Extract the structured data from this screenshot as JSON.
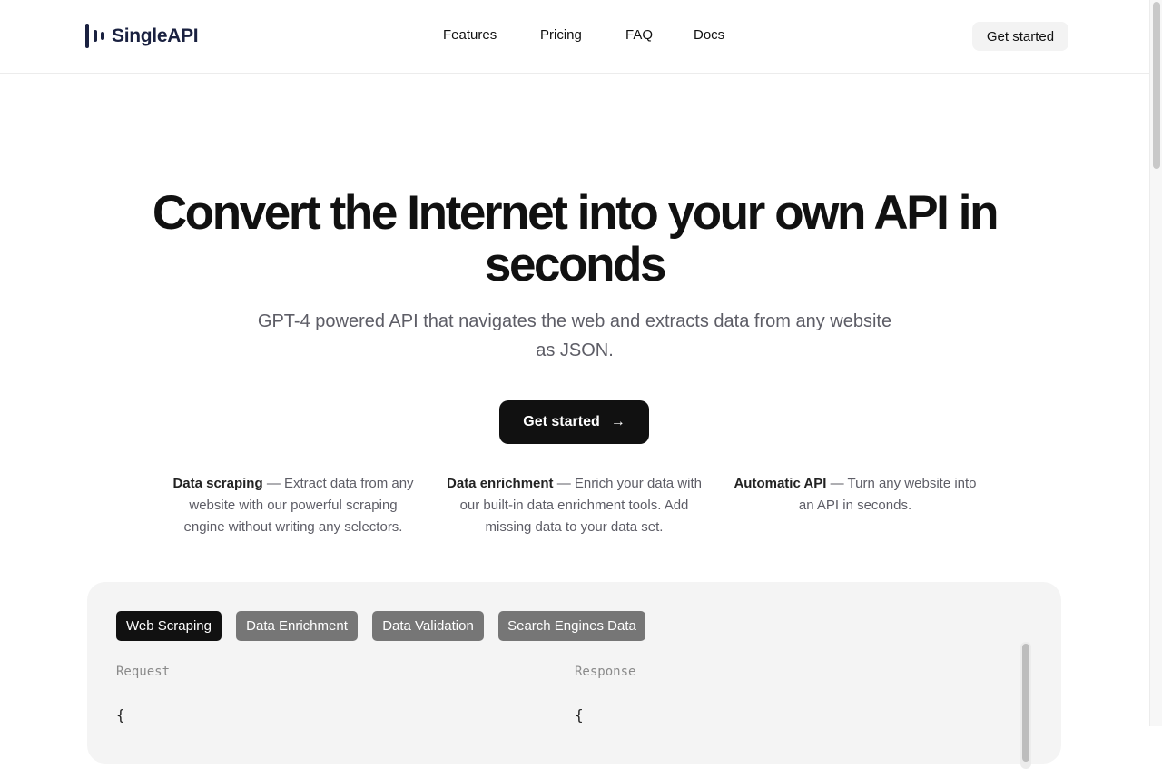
{
  "header": {
    "logo_text": "SingleAPI",
    "nav": [
      {
        "label": "Features"
      },
      {
        "label": "Pricing"
      },
      {
        "label": "FAQ"
      },
      {
        "label": "Docs"
      }
    ],
    "cta_label": "Get started"
  },
  "hero": {
    "title": "Convert the Internet into your own API in seconds",
    "subtitle": "GPT-4 powered API that navigates the web and extracts data from any website as JSON.",
    "cta_label": "Get started",
    "cta_icon": "arrow-right-icon"
  },
  "features": [
    {
      "title": "Data scraping",
      "separator": "—",
      "text": "Extract data from any website with our powerful scraping engine without writing any selectors."
    },
    {
      "title": "Data enrichment",
      "separator": "—",
      "text": "Enrich your data with our built-in data enrichment tools. Add missing data to your data set."
    },
    {
      "title": "Automatic API",
      "separator": "—",
      "text": "Turn any website into an API in seconds."
    }
  ],
  "demo": {
    "tabs": [
      {
        "label": "Web Scraping",
        "active": true
      },
      {
        "label": "Data Enrichment",
        "active": false
      },
      {
        "label": "Data Validation",
        "active": false
      },
      {
        "label": "Search Engines Data",
        "active": false
      }
    ],
    "request_label": "Request",
    "response_label": "Response",
    "request_code": "{",
    "response_code": "{"
  },
  "colors": {
    "primary_text": "#111111",
    "muted_text": "#5d5d66",
    "brand": "#1a2140",
    "tab_active": "#111111",
    "tab_inactive": "#767676",
    "panel_bg": "#f4f4f4"
  }
}
